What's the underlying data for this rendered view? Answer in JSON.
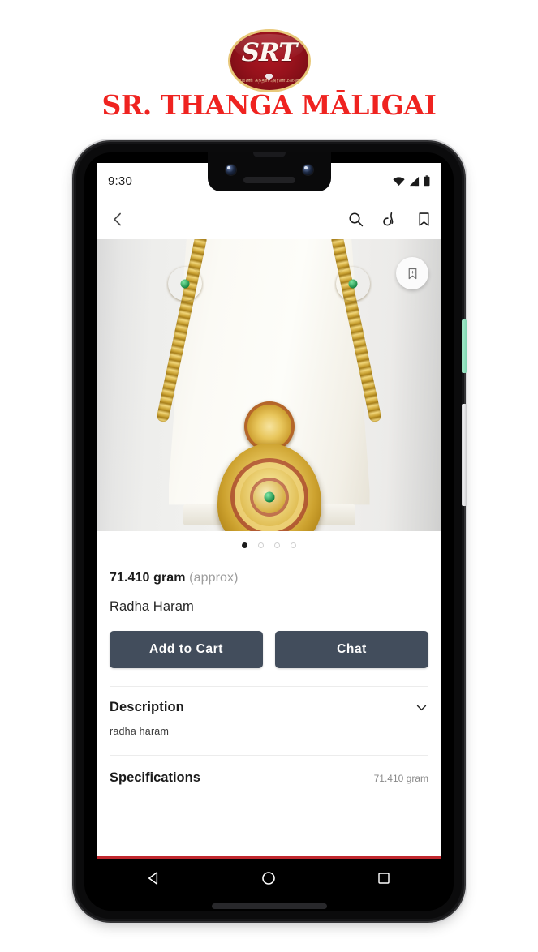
{
  "brand": {
    "logo_text": "SRT",
    "logo_tamil": "ரமணி  சுந்தரி  அரண்மனை",
    "logo_icon": "diamond-icon",
    "title": "SR. THANGA MĀLIGAI",
    "title_color": "#ef2320"
  },
  "phone": {
    "status_bar": {
      "time": "9:30",
      "icons": [
        "wifi-icon",
        "cellular-signal-icon",
        "battery-icon"
      ]
    },
    "app_bar": {
      "back_icon": "back-chevron-icon",
      "actions": [
        {
          "icon": "search-icon",
          "name": "search-button"
        },
        {
          "icon": "share-icon",
          "name": "share-button"
        },
        {
          "icon": "bookmark-icon",
          "name": "bookmark-button"
        }
      ]
    },
    "media": {
      "alt": "gold radha haram necklace on display stand",
      "save_fab_icon": "bookmark-save-icon",
      "carousel": {
        "total": 4,
        "active_index": 0
      }
    },
    "product": {
      "weight_value": "71.410 gram",
      "weight_note": "(approx)",
      "name": "Radha Haram",
      "primary_button": "Add to Cart",
      "secondary_button": "Chat"
    },
    "description_section": {
      "title": "Description",
      "chevron_icon": "chevron-down-icon",
      "body": "radha haram"
    },
    "specifications_section": {
      "title": "Specifications",
      "value": "71.410 gram"
    },
    "nav_bar": {
      "back_icon": "triangle-back-icon",
      "home_icon": "circle-home-icon",
      "recents_icon": "square-recents-icon"
    },
    "hardware": {
      "power_button_color": "#92e3bd",
      "volume_button_color": "#dddddf"
    }
  }
}
